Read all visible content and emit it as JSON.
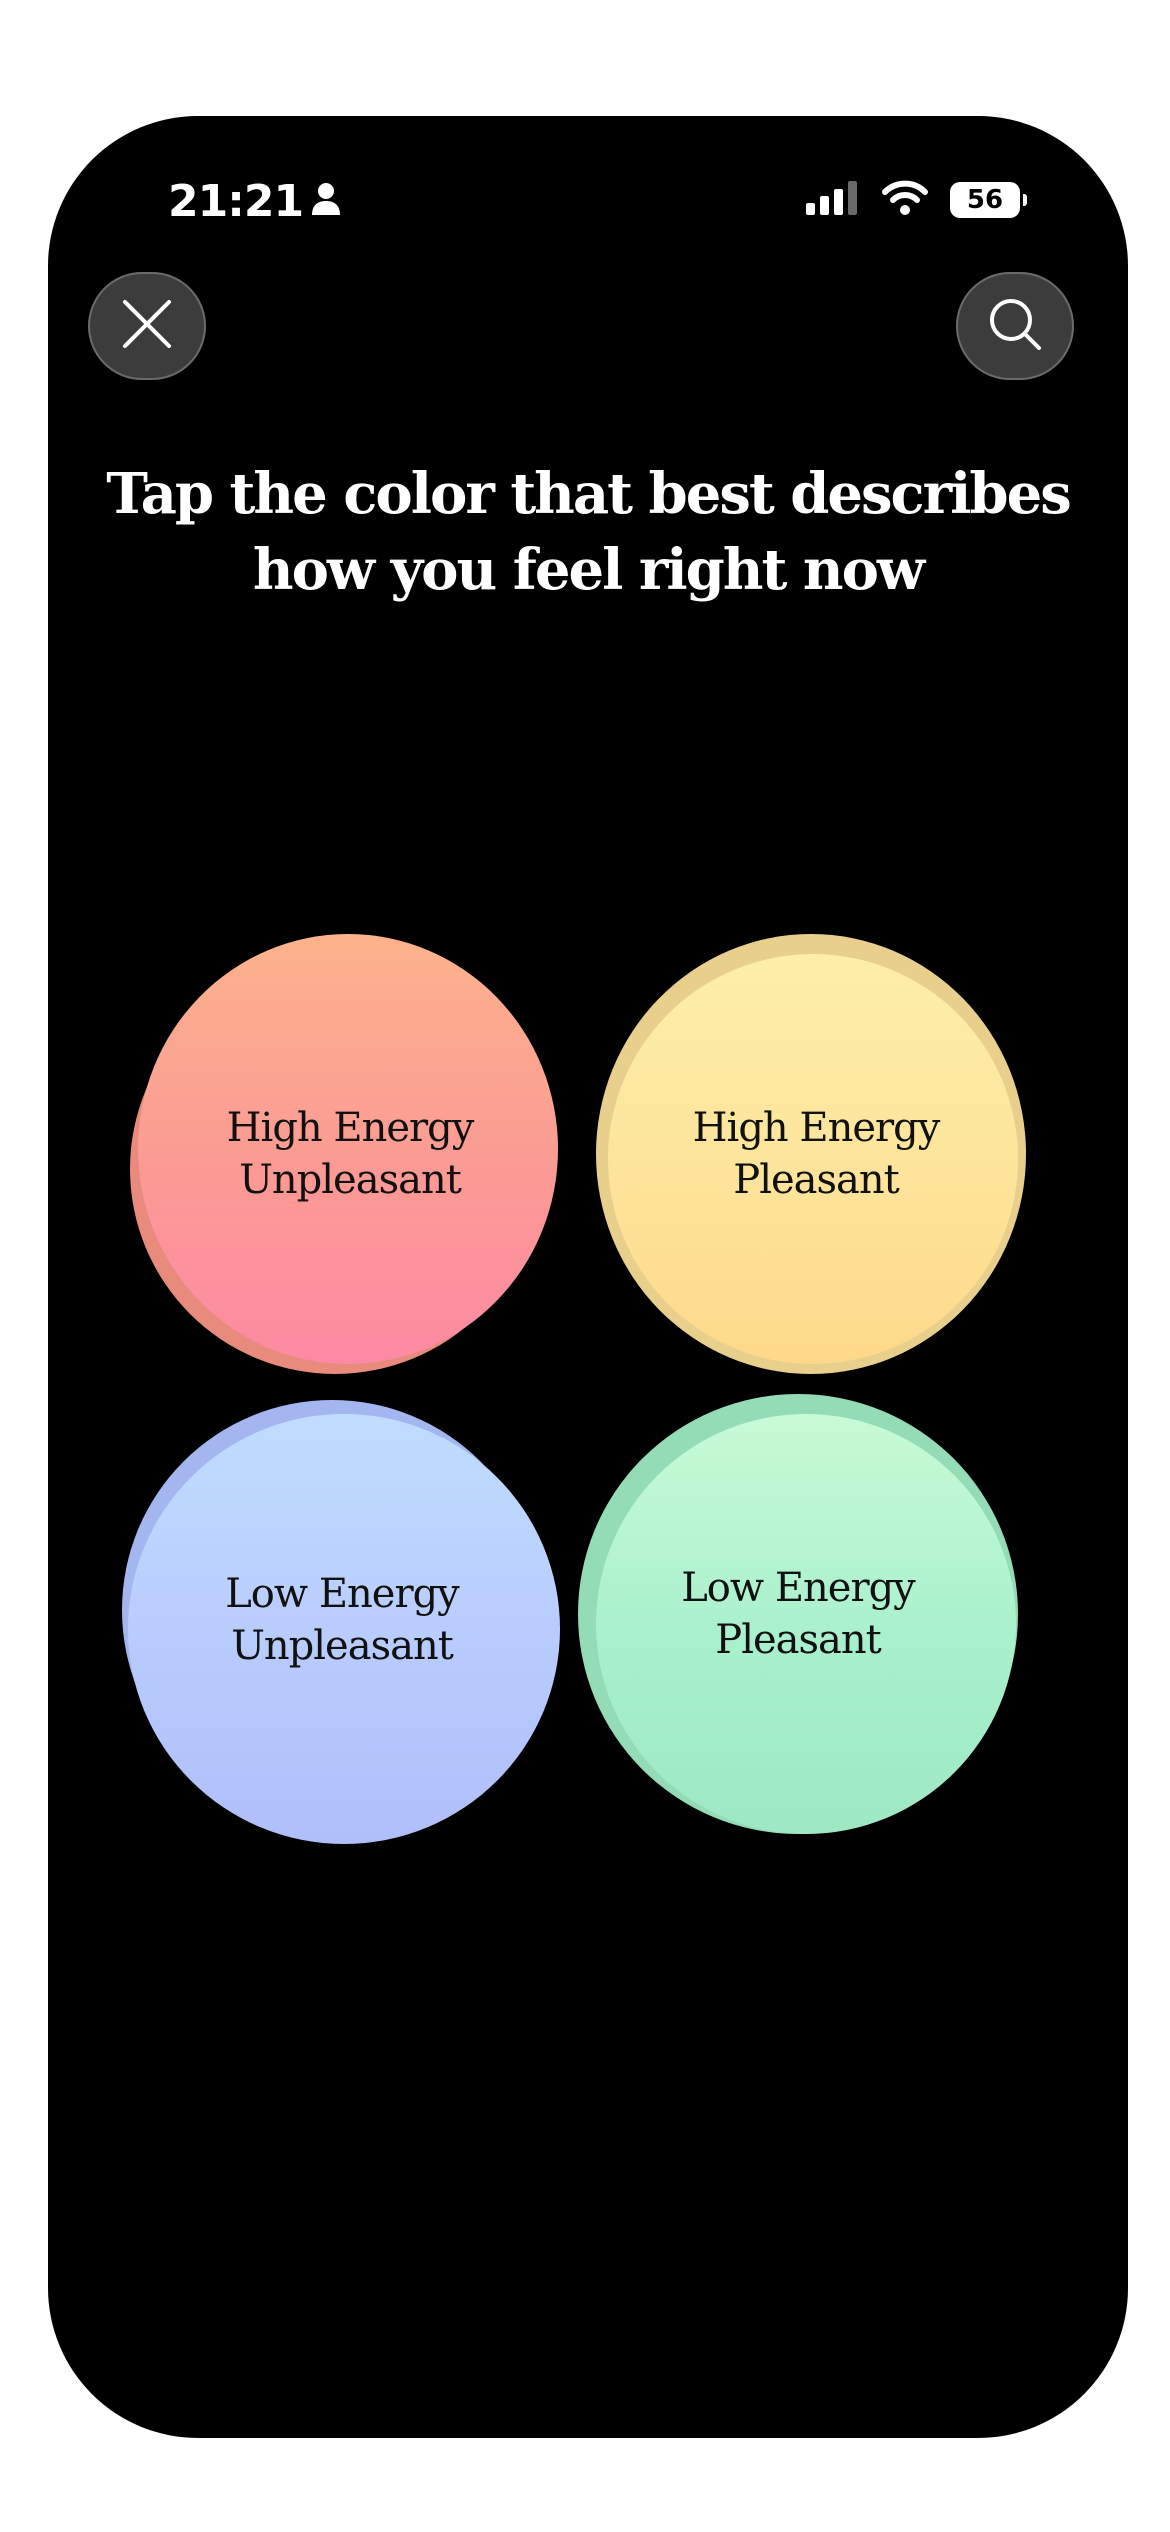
{
  "status_bar": {
    "time": "21:21",
    "battery": "56",
    "icons": [
      "person-icon",
      "cellular-signal-icon",
      "wifi-icon",
      "battery-icon"
    ]
  },
  "header": {
    "close_icon": "close-icon",
    "search_icon": "search-icon"
  },
  "main": {
    "title_line1": "Tap the color that best describes",
    "title_line2": "how you feel right now"
  },
  "moods": [
    {
      "line1": "High Energy",
      "line2": "Unpleasant",
      "color": "#fb9a94"
    },
    {
      "line1": "High Energy",
      "line2": "Pleasant",
      "color": "#fde49a"
    },
    {
      "line1": "Low Energy",
      "line2": "Unpleasant",
      "color": "#b8cbfd"
    },
    {
      "line1": "Low Energy",
      "line2": "Pleasant",
      "color": "#a8f0cc"
    }
  ]
}
